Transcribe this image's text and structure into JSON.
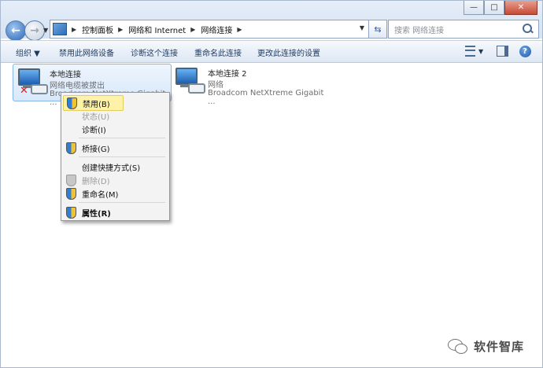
{
  "window": {
    "minimize_label": "—",
    "maximize_label": "□",
    "close_label": "✕"
  },
  "nav": {
    "back_label": "←",
    "forward_label": "→",
    "dropdown_label": "▼"
  },
  "address": {
    "breadcrumbs": [
      "控制面板",
      "网络和 Internet",
      "网络连接"
    ],
    "separator": "▶",
    "dropdown_label": "▼"
  },
  "refresh_label": "⇆",
  "search": {
    "placeholder": "搜索 网络连接"
  },
  "toolbar": {
    "organize": "组织 ▼",
    "disable_device": "禁用此网络设备",
    "diagnose": "诊断这个连接",
    "rename": "重命名此连接",
    "change_settings": "更改此连接的设置",
    "view_dropdown": "▼",
    "help_label": "?"
  },
  "connections": [
    {
      "name": "本地连接",
      "status": "网络电缆被拔出",
      "device": "Broadcom NetXtreme Gigabit ...",
      "status_icon": "red-x-icon"
    },
    {
      "name": "本地连接 2",
      "status": "网络",
      "device": "Broadcom NetXtreme Gigabit ...",
      "status_icon": "none"
    }
  ],
  "context_menu": {
    "items": [
      {
        "label": "禁用(B)",
        "enabled": true,
        "highlighted": true,
        "icon": "uac-shield-icon"
      },
      {
        "label": "状态(U)",
        "enabled": false
      },
      {
        "label": "诊断(I)",
        "enabled": true
      },
      {
        "label": "桥接(G)",
        "enabled": true,
        "icon": "uac-shield-icon"
      },
      {
        "label": "创建快捷方式(S)",
        "enabled": true
      },
      {
        "label": "删除(D)",
        "enabled": false,
        "icon": "uac-shield-icon"
      },
      {
        "label": "重命名(M)",
        "enabled": true,
        "icon": "uac-shield-icon"
      },
      {
        "label": "属性(R)",
        "enabled": true,
        "bold": true,
        "icon": "uac-shield-icon"
      }
    ]
  },
  "watermark": {
    "text": "软件智库",
    "icon": "wechat-icon"
  },
  "colors": {
    "toolbar_text": "#1e3a5f",
    "selection": "#d8e8fb",
    "menu_highlight": "#fdf2a7",
    "error_x": "#e21b1b"
  }
}
